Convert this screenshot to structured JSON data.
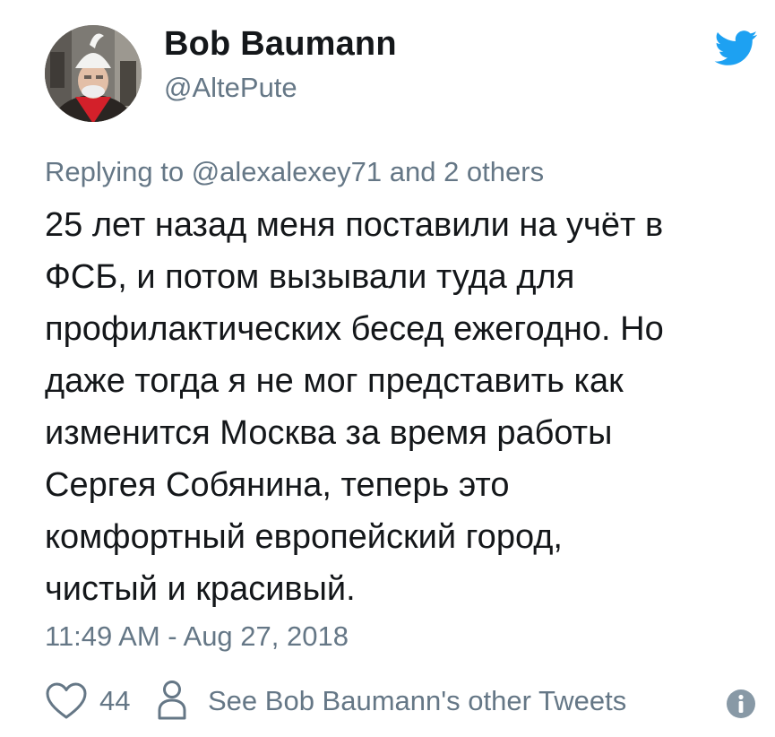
{
  "author": {
    "name": "Bob Baumann",
    "handle": "@AltePute"
  },
  "reply": {
    "text": "Replying to @alexalexey71 and 2 others"
  },
  "tweet": {
    "lines": [
      "25 лет назад меня поставили на учёт в",
      "ФСБ, и потом вызывали туда для",
      "профилактических бесед ежегодно. Но",
      "даже тогда я не мог представить как",
      "изменится Москва за время работы",
      "Сергея Собянина, теперь это",
      "комфортный европейский город,",
      "чистый и красивый."
    ]
  },
  "timestamp": "11:49 AM - Aug 27, 2018",
  "actions": {
    "like_count": "44",
    "other_tweets_label": "See Bob Baumann's other Tweets"
  },
  "icons": {
    "brand": "twitter-bird-icon",
    "like": "heart-icon",
    "profile": "person-icon",
    "info": "info-icon"
  },
  "colors": {
    "brand_blue": "#1da1f2",
    "text": "#14171a",
    "secondary_text": "#657786",
    "info_icon": "#8899a6"
  }
}
